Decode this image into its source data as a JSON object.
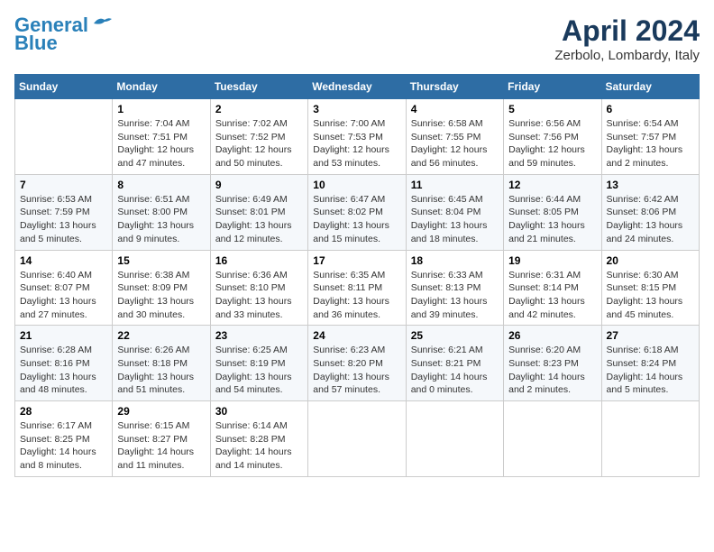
{
  "header": {
    "logo_line1": "General",
    "logo_line2": "Blue",
    "title": "April 2024",
    "location": "Zerbolo, Lombardy, Italy"
  },
  "calendar": {
    "weekdays": [
      "Sunday",
      "Monday",
      "Tuesday",
      "Wednesday",
      "Thursday",
      "Friday",
      "Saturday"
    ],
    "weeks": [
      [
        {
          "day": "",
          "info": ""
        },
        {
          "day": "1",
          "info": "Sunrise: 7:04 AM\nSunset: 7:51 PM\nDaylight: 12 hours\nand 47 minutes."
        },
        {
          "day": "2",
          "info": "Sunrise: 7:02 AM\nSunset: 7:52 PM\nDaylight: 12 hours\nand 50 minutes."
        },
        {
          "day": "3",
          "info": "Sunrise: 7:00 AM\nSunset: 7:53 PM\nDaylight: 12 hours\nand 53 minutes."
        },
        {
          "day": "4",
          "info": "Sunrise: 6:58 AM\nSunset: 7:55 PM\nDaylight: 12 hours\nand 56 minutes."
        },
        {
          "day": "5",
          "info": "Sunrise: 6:56 AM\nSunset: 7:56 PM\nDaylight: 12 hours\nand 59 minutes."
        },
        {
          "day": "6",
          "info": "Sunrise: 6:54 AM\nSunset: 7:57 PM\nDaylight: 13 hours\nand 2 minutes."
        }
      ],
      [
        {
          "day": "7",
          "info": "Sunrise: 6:53 AM\nSunset: 7:59 PM\nDaylight: 13 hours\nand 5 minutes."
        },
        {
          "day": "8",
          "info": "Sunrise: 6:51 AM\nSunset: 8:00 PM\nDaylight: 13 hours\nand 9 minutes."
        },
        {
          "day": "9",
          "info": "Sunrise: 6:49 AM\nSunset: 8:01 PM\nDaylight: 13 hours\nand 12 minutes."
        },
        {
          "day": "10",
          "info": "Sunrise: 6:47 AM\nSunset: 8:02 PM\nDaylight: 13 hours\nand 15 minutes."
        },
        {
          "day": "11",
          "info": "Sunrise: 6:45 AM\nSunset: 8:04 PM\nDaylight: 13 hours\nand 18 minutes."
        },
        {
          "day": "12",
          "info": "Sunrise: 6:44 AM\nSunset: 8:05 PM\nDaylight: 13 hours\nand 21 minutes."
        },
        {
          "day": "13",
          "info": "Sunrise: 6:42 AM\nSunset: 8:06 PM\nDaylight: 13 hours\nand 24 minutes."
        }
      ],
      [
        {
          "day": "14",
          "info": "Sunrise: 6:40 AM\nSunset: 8:07 PM\nDaylight: 13 hours\nand 27 minutes."
        },
        {
          "day": "15",
          "info": "Sunrise: 6:38 AM\nSunset: 8:09 PM\nDaylight: 13 hours\nand 30 minutes."
        },
        {
          "day": "16",
          "info": "Sunrise: 6:36 AM\nSunset: 8:10 PM\nDaylight: 13 hours\nand 33 minutes."
        },
        {
          "day": "17",
          "info": "Sunrise: 6:35 AM\nSunset: 8:11 PM\nDaylight: 13 hours\nand 36 minutes."
        },
        {
          "day": "18",
          "info": "Sunrise: 6:33 AM\nSunset: 8:13 PM\nDaylight: 13 hours\nand 39 minutes."
        },
        {
          "day": "19",
          "info": "Sunrise: 6:31 AM\nSunset: 8:14 PM\nDaylight: 13 hours\nand 42 minutes."
        },
        {
          "day": "20",
          "info": "Sunrise: 6:30 AM\nSunset: 8:15 PM\nDaylight: 13 hours\nand 45 minutes."
        }
      ],
      [
        {
          "day": "21",
          "info": "Sunrise: 6:28 AM\nSunset: 8:16 PM\nDaylight: 13 hours\nand 48 minutes."
        },
        {
          "day": "22",
          "info": "Sunrise: 6:26 AM\nSunset: 8:18 PM\nDaylight: 13 hours\nand 51 minutes."
        },
        {
          "day": "23",
          "info": "Sunrise: 6:25 AM\nSunset: 8:19 PM\nDaylight: 13 hours\nand 54 minutes."
        },
        {
          "day": "24",
          "info": "Sunrise: 6:23 AM\nSunset: 8:20 PM\nDaylight: 13 hours\nand 57 minutes."
        },
        {
          "day": "25",
          "info": "Sunrise: 6:21 AM\nSunset: 8:21 PM\nDaylight: 14 hours\nand 0 minutes."
        },
        {
          "day": "26",
          "info": "Sunrise: 6:20 AM\nSunset: 8:23 PM\nDaylight: 14 hours\nand 2 minutes."
        },
        {
          "day": "27",
          "info": "Sunrise: 6:18 AM\nSunset: 8:24 PM\nDaylight: 14 hours\nand 5 minutes."
        }
      ],
      [
        {
          "day": "28",
          "info": "Sunrise: 6:17 AM\nSunset: 8:25 PM\nDaylight: 14 hours\nand 8 minutes."
        },
        {
          "day": "29",
          "info": "Sunrise: 6:15 AM\nSunset: 8:27 PM\nDaylight: 14 hours\nand 11 minutes."
        },
        {
          "day": "30",
          "info": "Sunrise: 6:14 AM\nSunset: 8:28 PM\nDaylight: 14 hours\nand 14 minutes."
        },
        {
          "day": "",
          "info": ""
        },
        {
          "day": "",
          "info": ""
        },
        {
          "day": "",
          "info": ""
        },
        {
          "day": "",
          "info": ""
        }
      ]
    ]
  }
}
